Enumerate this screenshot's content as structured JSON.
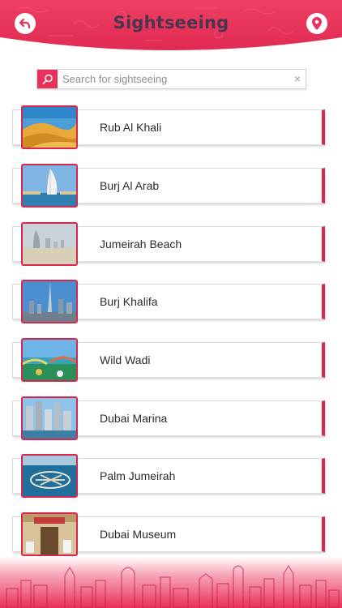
{
  "header": {
    "title": "Sightseeing",
    "back_icon": "back-arrow-icon",
    "location_icon": "location-pin-icon",
    "accent_color": "#e8305a"
  },
  "search": {
    "placeholder": "Search for sightseeing",
    "icon": "search-icon",
    "clear_icon": "close-icon",
    "clear_glyph": "×"
  },
  "list": {
    "items": [
      {
        "label": "Rub Al Khali"
      },
      {
        "label": "Burj Al Arab"
      },
      {
        "label": "Jumeirah Beach"
      },
      {
        "label": "Burj Khalifa"
      },
      {
        "label": "Wild Wadi"
      },
      {
        "label": "Dubai Marina"
      },
      {
        "label": "Palm Jumeirah"
      },
      {
        "label": "Dubai Museum"
      }
    ]
  }
}
